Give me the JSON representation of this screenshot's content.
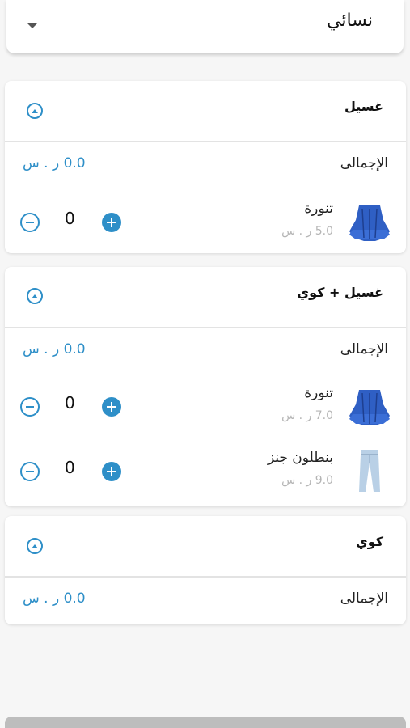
{
  "dropdown": {
    "selected": "نسائي"
  },
  "sections": [
    {
      "title": "غسيل",
      "total_label": "الإجمالى",
      "total_value": "0.0 ر . س",
      "items": [
        {
          "name": "تنورة",
          "price": "5.0 ر . س",
          "qty": "0",
          "image": "skirt-image"
        }
      ]
    },
    {
      "title": "غسيل + كوي",
      "total_label": "الإجمالى",
      "total_value": "0.0 ر . س",
      "items": [
        {
          "name": "تنورة",
          "price": "7.0 ر . س",
          "qty": "0",
          "image": "skirt-image"
        },
        {
          "name": "بنطلون جنز",
          "price": "9.0 ر . س",
          "qty": "0",
          "image": "jeans-image"
        }
      ]
    },
    {
      "title": "كوي",
      "total_label": "الإجمالى",
      "total_value": "0.0 ر . س",
      "items": []
    }
  ],
  "colors": {
    "accent": "#2e8fc8",
    "price_grey": "#b5b5b5",
    "divider": "#e3e3e3"
  }
}
